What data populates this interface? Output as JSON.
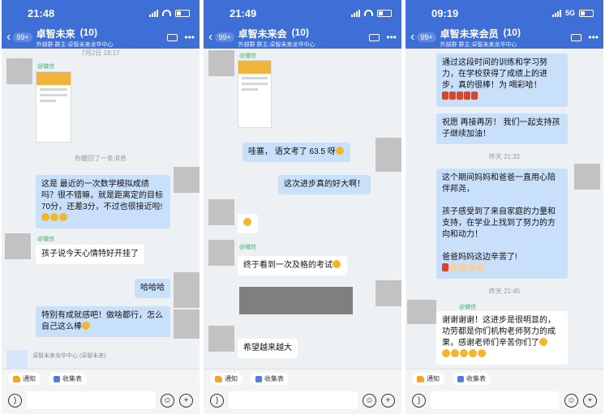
{
  "screens": [
    {
      "time": "21:48",
      "network": "",
      "unread_badge": "99+",
      "group_title": "卓智未来",
      "member_count": "(10)",
      "subtitle": "外部群  群主:卓智未来龙华中心",
      "timestamp": "7月2日 18:17",
      "recall_notice": "你撤回了一条消息",
      "sender_tag": "@微信",
      "msg_math": "这是    最近的一次数学模拟成绩吗？很不错嘛，就是距离定的目标70分，还差3分，不过也很接近啦!",
      "msg_happy": "孩子说今天心情特好开挂了",
      "msg_haha": "哈哈哈",
      "msg_proud": "特别有成就感吧！做啥都行，怎么自己这么棒",
      "org_name": "卓智未来龙华中心 (卓智未来)"
    },
    {
      "time": "21:49",
      "network": "",
      "unread_badge": "99+",
      "group_title": "卓智未来会",
      "member_count": "(10)",
      "subtitle": "外部群  群主:卓智未来龙华中心",
      "sender_tag": "@微信",
      "msg_wow": "哇塞，      语文考了 63.5 呀",
      "msg_progress": "这次进步真的好大啊！",
      "msg_finally": "终于看到一次及格的考试",
      "msg_hope": "希望越来越大"
    },
    {
      "time": "09:19",
      "network": "5G",
      "unread_badge": "99+",
      "group_title": "卓智未来会员",
      "member_count": "(10)",
      "subtitle": "外部群  群主:卓智未来龙华中心",
      "msg_training": "通过这段时间的训练和学习努力，在学校获得了成绩上的进步，真的很棒！为    喝彩哈！",
      "msg_cheer": "祝愿    再接再厉！                 我们一起支持孩子继续加油！",
      "timestamp1": "昨天 21:32",
      "msg_parents": "这个期间妈妈和爸爸一直用心陪伴邦尧，\n\n孩子感受到了来自家庭的力量和支持，在学业上找到了努力的方向和动力！\n\n爸爸妈妈这边辛苦了!",
      "timestamp2": "昨天 21:45",
      "sender_tag": "@微信",
      "msg_thanks": "谢谢谢谢！这进步是很明显的，功劳都是你们机构老师努力的成果，感谢老师们辛苦你们了"
    }
  ],
  "bottom": {
    "notice_label": "通知",
    "form_label": "收集表"
  }
}
